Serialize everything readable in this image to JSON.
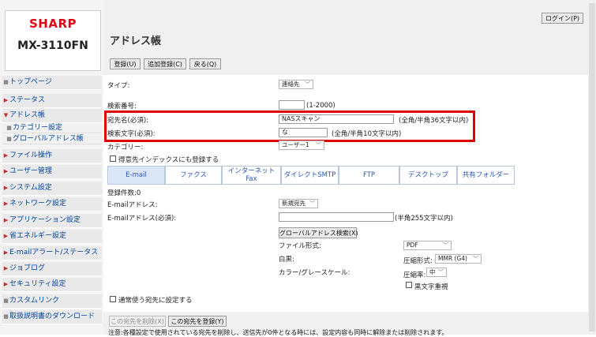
{
  "brand": "SHARP",
  "model": "MX-3110FN",
  "header": {
    "title": "アドレス帳",
    "login": "ログイン(P)"
  },
  "toolbar": {
    "register": "登録(U)",
    "add_register": "追加登録(C)",
    "back": "戻る(Q)"
  },
  "sidebar": {
    "items": [
      {
        "label": "トップページ"
      },
      {
        "label": "ステータス"
      },
      {
        "label": "アドレス帳"
      },
      {
        "label": "カテゴリー設定"
      },
      {
        "label": "グローバルアドレス帳"
      },
      {
        "label": "ファイル操作"
      },
      {
        "label": "ユーザー管理"
      },
      {
        "label": "システム設定"
      },
      {
        "label": "ネットワーク設定"
      },
      {
        "label": "アプリケーション設定"
      },
      {
        "label": "省エネルギー設定"
      },
      {
        "label": "E-mailアラート/ステータス"
      },
      {
        "label": "ジョブログ"
      },
      {
        "label": "セキュリティ設定"
      },
      {
        "label": "カスタムリンク"
      },
      {
        "label": "取扱説明書のダウンロード"
      }
    ]
  },
  "form": {
    "type_label": "タイプ:",
    "type_value": "連絡先",
    "search_no_label": "検索番号:",
    "search_no_value": "",
    "search_no_hint": "(1-2000)",
    "name_label": "宛先名(必須):",
    "name_value": "NASスキャン",
    "name_hint": "(全角/半角36文字以内)",
    "search_char_label": "検索文字(必須):",
    "search_char_value": "な",
    "search_char_hint": "(全角/半角10文字以内)",
    "category_label": "カテゴリー:",
    "category_value": "ユーザー1",
    "favorite_label": "得意先インデックスにも登録する",
    "favorite_checked": false
  },
  "tabs": [
    "E-mail",
    "ファクス",
    "インターネット\nFax",
    "ダイレクトSMTP",
    "FTP",
    "デスクトップ",
    "共有フォルダー"
  ],
  "email": {
    "registered_count": "登録件数:0",
    "address_label": "E-mailアドレス:",
    "address_select": "新規宛先",
    "address_required_label": "E-mailアドレス(必須):",
    "address_required_value": "",
    "address_hint": "(半角255文字以内)",
    "global_search_button": "グローバルアドレス検索(X)",
    "file_format_label": "ファイル形式:",
    "file_format_value": "PDF",
    "bw_label": "白黒:",
    "compression_label": "圧縮形式:",
    "compression_value": "MMR (G4)",
    "color_label": "カラー/グレースケール:",
    "ratio_label": "圧縮率:",
    "ratio_value": "中",
    "black_text_label": "黒文字重視"
  },
  "default_destination_label": "通常使う宛先に設定する",
  "footer": {
    "delete_button": "この宛先を削除(X)",
    "register_button": "この宛先を登録(Y)",
    "note": "注意:各種設定で使用されている宛先を削除し、送信先が0件となる時には、設定内容も同時に解除または削除されます。"
  },
  "colors": {
    "brand_red": "#e60012",
    "highlight_red": "#e00000",
    "link_blue": "#0044a0",
    "tab_blue": "#2a57b8"
  }
}
